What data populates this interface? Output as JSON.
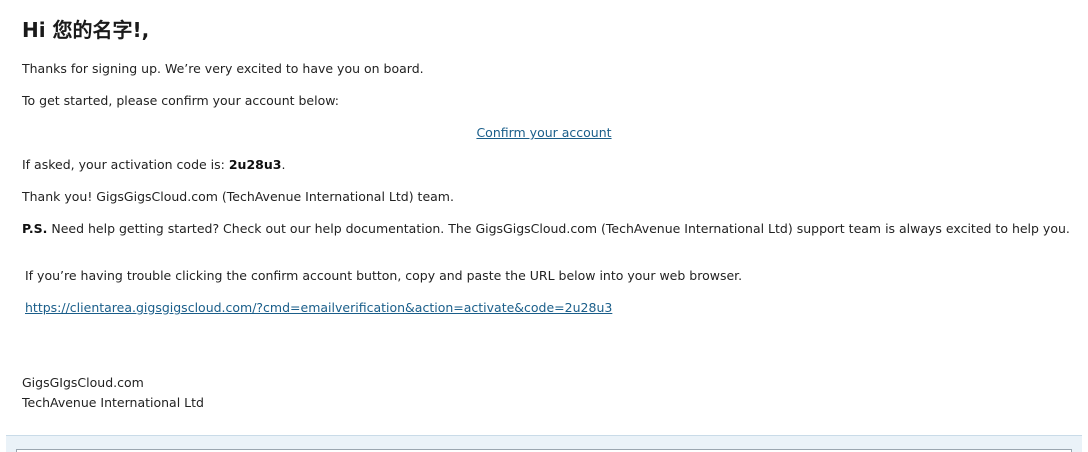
{
  "greeting": "Hi 您的名字!,",
  "intro": "Thanks for signing up. We’re very excited to have you on board.",
  "get_started": "To get started, please confirm your account below:",
  "confirm_link": "Confirm your account",
  "activation": {
    "prefix": "If asked, your activation code is: ",
    "code": "2u28u3",
    "suffix": "."
  },
  "thanks": "Thank you! GigsGigsCloud.com (TechAvenue International Ltd) team.",
  "ps": {
    "label": "P.S.",
    "text": " Need help getting started? Check out our help documentation. The GigsGigsCloud.com (TechAvenue International Ltd) support team is always excited to help you."
  },
  "trouble": "If you’re having trouble clicking the confirm account button, copy and paste the URL below into your web browser.",
  "verify_url": "https://clientarea.gigsgigscloud.com/?cmd=emailverification&action=activate&code=2u28u3",
  "signature": {
    "line1": "GigsGIgsCloud.com",
    "line2": "TechAvenue International Ltd"
  }
}
